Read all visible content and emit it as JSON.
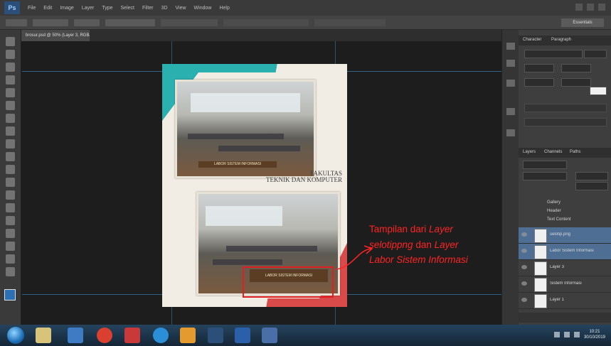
{
  "app": {
    "logo": "Ps",
    "menu": [
      "File",
      "Edit",
      "Image",
      "Layer",
      "Type",
      "Select",
      "Filter",
      "3D",
      "View",
      "Window",
      "Help"
    ]
  },
  "options_bar": {
    "workspace": "Essentials"
  },
  "document_tab": {
    "title": "brosur.psd @ 50% (Layer 3, RGB/8)"
  },
  "document": {
    "heading_line1": "FAKULTAS",
    "heading_line2": "TEKNIK DAN KOMPUTER",
    "photo_top_label": "LABOR SISTEM INFORMASI",
    "photo_bottom_label": "LABOR SISTEM INFORMASI",
    "colors": {
      "teal": "#2bb0b0",
      "red": "#d94a4a",
      "cream": "#f2ede4",
      "label_brown": "#5a3d22"
    }
  },
  "annotation": {
    "line1_plain": "Tampilan dari ",
    "line1_italic": "Layer",
    "line2_italic": "selotippng",
    "line2_plain": " dan ",
    "line2_italic2": "Layer",
    "line3_italic": "Labor Sistem Informasi",
    "color": "#ff2323"
  },
  "panels": {
    "top_tabs": [
      "Character",
      "Paragraph"
    ],
    "layers_tabs": [
      "Layers",
      "Channels",
      "Paths"
    ],
    "layers": [
      {
        "name": "selotip.png",
        "selected": true
      },
      {
        "name": "Labor Sistem Informasi",
        "selected": true
      },
      {
        "name": "Layer 3",
        "selected": false
      },
      {
        "name": "Sistem Informasi",
        "selected": false
      },
      {
        "name": "Layer 1",
        "selected": false
      }
    ],
    "groups": [
      "Gallery",
      "Header",
      "Text Content"
    ]
  },
  "taskbar": {
    "icons": [
      "explorer",
      "media",
      "chrome",
      "gmail",
      "ie",
      "folder",
      "photoshop",
      "word",
      "illustrator"
    ],
    "time": "10:21",
    "date": "30/10/2019"
  }
}
